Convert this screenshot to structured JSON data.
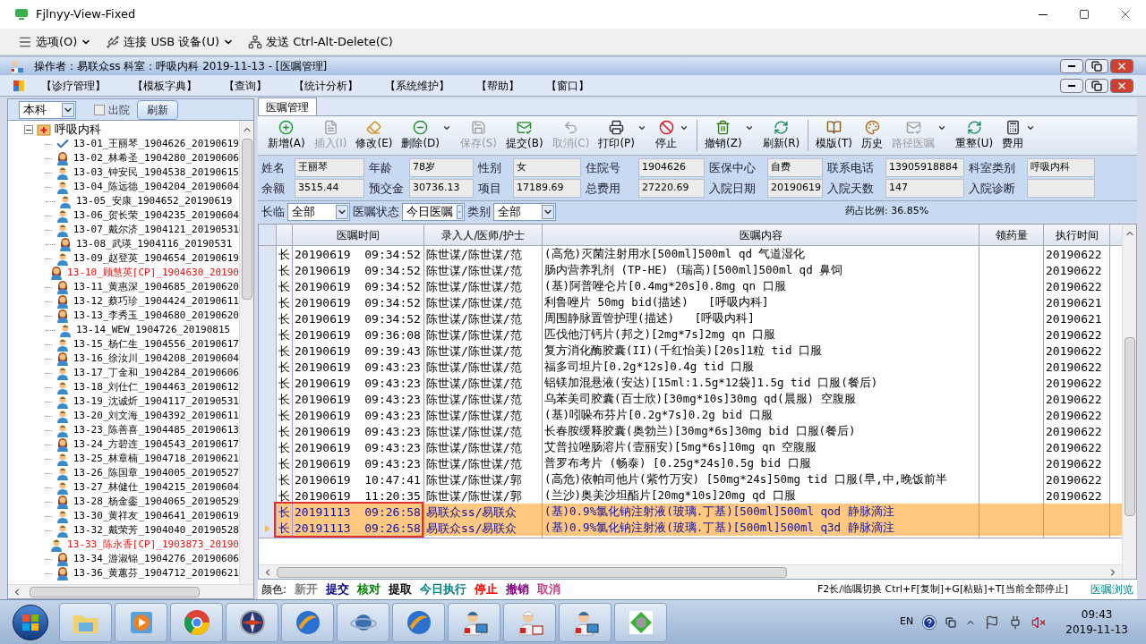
{
  "window": {
    "title": "Fjlnyy-View-Fixed"
  },
  "viewer_toolbar": [
    {
      "label": "选项(O)",
      "kind": "menu"
    },
    {
      "label": "连接 USB 设备(U)",
      "kind": "usb"
    },
    {
      "label": "发送 Ctrl-Alt-Delete(C)",
      "kind": "network"
    }
  ],
  "app_title": "操作者：易联众ss  科室：呼吸内科  2019-11-13 - [医嘱管理]",
  "menu": [
    "【诊疗管理】",
    "【模板字典】",
    "【查询】",
    "【统计分析】",
    "【系统维护】",
    "【帮助】",
    "【窗口】"
  ],
  "left_panel": {
    "scope": "本科",
    "discharged": {
      "label": "出院",
      "checked": false
    },
    "refresh": "刷新",
    "tree": {
      "label": "呼吸内科",
      "expanded": true,
      "children": [
        {
          "label": "13-01_王丽琴_1904626_20190619",
          "kind": "check",
          "highlighted": false
        },
        {
          "label": "13-02_林希圣_1904280_20190606",
          "kind": "female",
          "highlighted": false
        },
        {
          "label": "13-03_钟安民_1904538_20190615",
          "kind": "male",
          "highlighted": false
        },
        {
          "label": "13-04_陈远德_1904204_20190604",
          "kind": "male",
          "highlighted": false
        },
        {
          "label": "13-05_安康_1904652_20190619",
          "kind": "male",
          "highlighted": false
        },
        {
          "label": "13-06_贺长荣_1904235_20190604",
          "kind": "male",
          "highlighted": false
        },
        {
          "label": "13-07_戴尔济_1904121_20190531",
          "kind": "male",
          "highlighted": false
        },
        {
          "label": "13-08_武瑛_1904116_20190531",
          "kind": "female",
          "highlighted": false
        },
        {
          "label": "13-09_赵登英_1904654_20190619",
          "kind": "male",
          "highlighted": false
        },
        {
          "label": "13-10_顾慧英[CP]_1904630_20190",
          "kind": "female",
          "highlighted": true
        },
        {
          "label": "13-11_黄惠深_1904685_20190620",
          "kind": "female",
          "highlighted": false
        },
        {
          "label": "13-12_蔡巧珍_1904424_20190611",
          "kind": "female",
          "highlighted": false
        },
        {
          "label": "13-13_李秀玉_1904680_20190620",
          "kind": "female",
          "highlighted": false
        },
        {
          "label": "13-14_WEW_1904726_20190815",
          "kind": "male",
          "highlighted": false
        },
        {
          "label": "13-15_杨仁生_1904556_20190617",
          "kind": "male",
          "highlighted": false
        },
        {
          "label": "13-16_徐汝川_1904208_20190604",
          "kind": "female",
          "highlighted": false
        },
        {
          "label": "13-17_丁金和_1904284_20190606",
          "kind": "male",
          "highlighted": false
        },
        {
          "label": "13-18_刘仕仁_1904463_20190612",
          "kind": "male",
          "highlighted": false
        },
        {
          "label": "13-19_沈诚炘_1904117_20190531",
          "kind": "male",
          "highlighted": false
        },
        {
          "label": "13-20_刘文海_1904392_20190611",
          "kind": "male",
          "highlighted": false
        },
        {
          "label": "13-23_陈善喜_1904485_20190613",
          "kind": "male",
          "highlighted": false
        },
        {
          "label": "13-24_方碧连_1904543_20190617",
          "kind": "female",
          "highlighted": false
        },
        {
          "label": "13-25_林章楠_1904718_20190621",
          "kind": "male",
          "highlighted": false
        },
        {
          "label": "13-26_陈国章_1904005_20190527",
          "kind": "male",
          "highlighted": false
        },
        {
          "label": "13-27_林健仕_1904215_20190604",
          "kind": "male",
          "highlighted": false
        },
        {
          "label": "13-28_杨金銮_1904065_20190529",
          "kind": "female",
          "highlighted": false
        },
        {
          "label": "13-30_黄祥友_1904641_20190619",
          "kind": "male",
          "highlighted": false
        },
        {
          "label": "13-32_戴荣芳_1904040_20190528",
          "kind": "male",
          "highlighted": false
        },
        {
          "label": "13-33_陈永香[CP]_1903873_20190",
          "kind": "male",
          "highlighted": true
        },
        {
          "label": "13-34_游淑锦_1904276_20190606",
          "kind": "female",
          "highlighted": false
        },
        {
          "label": "13-36_黄蕙芬_1904712_20190621",
          "kind": "female",
          "highlighted": false
        }
      ]
    }
  },
  "tab": {
    "label": "医嘱管理",
    "selected": true
  },
  "toolbar": [
    {
      "label": "新增(A)",
      "kind": "add",
      "disabled": false,
      "dropdown": false,
      "separator_before": false
    },
    {
      "label": "插入(I)",
      "kind": "insert",
      "disabled": true,
      "dropdown": false,
      "separator_before": false
    },
    {
      "label": "修改(E)",
      "kind": "edit",
      "disabled": false,
      "dropdown": false,
      "separator_before": false
    },
    {
      "label": "删除(D)",
      "kind": "delete",
      "disabled": false,
      "dropdown": true,
      "separator_before": false
    },
    {
      "label": "保存(S)",
      "kind": "save",
      "disabled": true,
      "dropdown": false,
      "separator_before": false
    },
    {
      "label": "提交(B)",
      "kind": "submit",
      "disabled": false,
      "dropdown": false,
      "separator_before": false
    },
    {
      "label": "取消(C)",
      "kind": "undo",
      "disabled": true,
      "dropdown": false,
      "separator_before": false
    },
    {
      "label": "打印(P)",
      "kind": "print",
      "disabled": false,
      "dropdown": true,
      "separator_before": false
    },
    {
      "label": "停止",
      "kind": "stop",
      "disabled": false,
      "dropdown": true,
      "separator_before": false
    },
    {
      "label": "撤销(Z)",
      "kind": "trash",
      "disabled": false,
      "dropdown": true,
      "separator_before": true
    },
    {
      "label": "刷新(R)",
      "kind": "refresh",
      "disabled": false,
      "dropdown": false,
      "separator_before": false
    },
    {
      "label": "模版(T)",
      "kind": "book",
      "disabled": false,
      "dropdown": false,
      "separator_before": true
    },
    {
      "label": "历史",
      "kind": "palette",
      "disabled": false,
      "dropdown": false,
      "separator_before": false
    },
    {
      "label": "路径医嘱",
      "kind": "submit",
      "disabled": true,
      "dropdown": true,
      "separator_before": false
    },
    {
      "label": "重整(U)",
      "kind": "refresh",
      "disabled": false,
      "dropdown": false,
      "separator_before": false
    },
    {
      "label": "费用",
      "kind": "calculator",
      "disabled": false,
      "dropdown": true,
      "separator_before": false
    }
  ],
  "patient": [
    [
      {
        "label": "姓名",
        "value": "王丽琴"
      },
      {
        "label": "年龄",
        "value": "78岁"
      },
      {
        "label": "性别",
        "value": "女"
      },
      {
        "label": "住院号",
        "value": "1904626"
      },
      {
        "label": "医保中心",
        "value": "自费"
      },
      {
        "label": "联系电话",
        "value": "13905918884"
      },
      {
        "label": "科室类别",
        "value": "呼吸内科"
      }
    ],
    [
      {
        "label": "余额",
        "value": "3515.44"
      },
      {
        "label": "预交金",
        "value": "30736.13"
      },
      {
        "label": "项目",
        "value": "17189.69"
      },
      {
        "label": "总费用",
        "value": "27220.69"
      },
      {
        "label": "入院日期",
        "value": "20190619"
      },
      {
        "label": "入院天数",
        "value": "147"
      },
      {
        "label": "入院诊断"
      }
    ]
  ],
  "filters": [
    {
      "label": "长临",
      "value": "全部"
    },
    {
      "label": "医嘱状态",
      "value": "今日医嘱"
    },
    {
      "label": "类别",
      "value": "全部"
    }
  ],
  "drug_ratio": "药占比例: 36.85%",
  "table": {
    "columns": [
      "医嘱时间",
      "录入人/医师/护士",
      "医嘱内容",
      "领药量",
      "执行时间"
    ],
    "rows": [
      {
        "type": "长",
        "time": "20190619  09:34:52",
        "staff": "陈世谋/陈世谋/范",
        "content": "(高危)灭菌注射用水[500ml]500ml qd 气道湿化",
        "executed": "20190622",
        "selected": false,
        "current": false,
        "marked": false
      },
      {
        "type": "长",
        "time": "20190619  09:34:52",
        "staff": "陈世谋/陈世谋/范",
        "content": "肠内营养乳剂 (TP-HE) (瑞高)[500ml]500ml qd 鼻饲",
        "executed": "20190622",
        "selected": false,
        "current": false,
        "marked": false
      },
      {
        "type": "长",
        "time": "20190619  09:34:52",
        "staff": "陈世谋/陈世谋/范",
        "content": "(基)阿普唑仑片[0.4mg*20s]0.8mg qn 口服",
        "executed": "20190622",
        "selected": false,
        "current": false,
        "marked": false
      },
      {
        "type": "长",
        "time": "20190619  09:34:52",
        "staff": "陈世谋/陈世谋/范",
        "content": "利鲁唑片 50mg bid(描述)   [呼吸内科]",
        "executed": "20190621",
        "selected": false,
        "current": false,
        "marked": false
      },
      {
        "type": "长",
        "time": "20190619  09:34:52",
        "staff": "陈世谋/陈世谋/范",
        "content": "周围静脉置管护理(描述)   [呼吸内科]",
        "executed": "20190621",
        "selected": false,
        "current": false,
        "marked": false
      },
      {
        "type": "长",
        "time": "20190619  09:36:08",
        "staff": "陈世谋/陈世谋/范",
        "content": "匹伐他汀钙片(邦之)[2mg*7s]2mg qn 口服",
        "executed": "20190622",
        "selected": false,
        "current": false,
        "marked": false
      },
      {
        "type": "长",
        "time": "20190619  09:39:43",
        "staff": "陈世谋/陈世谋/范",
        "content": "复方消化酶胶囊(II)(千红怡美)[20s]1粒 tid 口服",
        "executed": "20190622",
        "selected": false,
        "current": false,
        "marked": false
      },
      {
        "type": "长",
        "time": "20190619  09:43:23",
        "staff": "陈世谋/陈世谋/范",
        "content": "福多司坦片[0.2g*12s]0.4g tid 口服",
        "executed": "20190622",
        "selected": false,
        "current": false,
        "marked": false
      },
      {
        "type": "长",
        "time": "20190619  09:43:23",
        "staff": "陈世谋/陈世谋/范",
        "content": "铝镁加混悬液(安达)[15ml:1.5g*12袋]1.5g tid 口服(餐后)",
        "executed": "20190622",
        "selected": false,
        "current": false,
        "marked": false
      },
      {
        "type": "长",
        "time": "20190619  09:43:23",
        "staff": "陈世谋/陈世谋/范",
        "content": "乌苯美司胶囊(百士欣)[30mg*10s]30mg qd(晨服) 空腹服",
        "executed": "20190622",
        "selected": false,
        "current": false,
        "marked": false
      },
      {
        "type": "长",
        "time": "20190619  09:43:23",
        "staff": "陈世谋/陈世谋/范",
        "content": "(基)吲哚布芬片[0.2g*7s]0.2g bid 口服",
        "executed": "20190622",
        "selected": false,
        "current": false,
        "marked": false
      },
      {
        "type": "长",
        "time": "20190619  09:43:23",
        "staff": "陈世谋/陈世谋/范",
        "content": "长春胺缓释胶囊(奥勃兰)[30mg*6s]30mg bid 口服(餐后)",
        "executed": "20190622",
        "selected": false,
        "current": false,
        "marked": false
      },
      {
        "type": "长",
        "time": "20190619  09:43:23",
        "staff": "陈世谋/陈世谋/范",
        "content": "艾普拉唑肠溶片(壹丽安)[5mg*6s]10mg qn 空腹服",
        "executed": "20190622",
        "selected": false,
        "current": false,
        "marked": false
      },
      {
        "type": "长",
        "time": "20190619  09:43:23",
        "staff": "陈世谋/陈世谋/范",
        "content": "普罗布考片 (畅泰) [0.25g*24s]0.5g bid 口服",
        "executed": "20190622",
        "selected": false,
        "current": false,
        "marked": false
      },
      {
        "type": "长",
        "time": "20190619  10:47:41",
        "staff": "陈世谋/陈世谋/郭",
        "content": "(高危)依帕司他片(紫竹万安) [50mg*24s]50mg tid 口服(早,中,晚饭前半",
        "executed": "20190622",
        "selected": false,
        "current": false,
        "marked": false
      },
      {
        "type": "长",
        "time": "20190619  11:20:35",
        "staff": "陈世谋/陈世谋/郭",
        "content": "(兰沙)奥美沙坦酯片[20mg*10s]20mg qd 口服",
        "executed": "20190622",
        "selected": false,
        "current": false,
        "marked": false
      },
      {
        "type": "长",
        "time": "20191113  09:26:58",
        "staff": "易联众ss/易联众",
        "content": "(基)0.9%氯化钠注射液(玻璃.丁基)[500ml]500ml qod 静脉滴注",
        "selected": true,
        "current": false,
        "marked": true
      },
      {
        "type": "长",
        "time": "20191113  09:26:58",
        "staff": "易联众ss/易联众",
        "content": "(基)0.9%氯化钠注射液(玻璃.丁基)[500ml]500ml q3d 静脉滴注",
        "selected": true,
        "current": true,
        "marked": true
      }
    ]
  },
  "legend": {
    "label": "颜色:",
    "items": [
      {
        "label": "新开",
        "color": "#808080"
      },
      {
        "label": "提交",
        "color": "#000080"
      },
      {
        "label": "核对",
        "color": "#008000"
      },
      {
        "label": "提取",
        "color": "#000000"
      },
      {
        "label": "今日执行",
        "color": "#008080"
      },
      {
        "label": "停止",
        "color": "#ff0000"
      },
      {
        "label": "撤销",
        "color": "#800080"
      },
      {
        "label": "取消",
        "color": "#c04080"
      }
    ],
    "shortcuts": "F2长/临嘱切换 Ctrl+F[复制]+G[粘贴]+T[当前全部停止]",
    "link": "医嘱浏览"
  },
  "tray": {
    "language": "EN",
    "time": "09:43",
    "date": "2019-11-13"
  }
}
